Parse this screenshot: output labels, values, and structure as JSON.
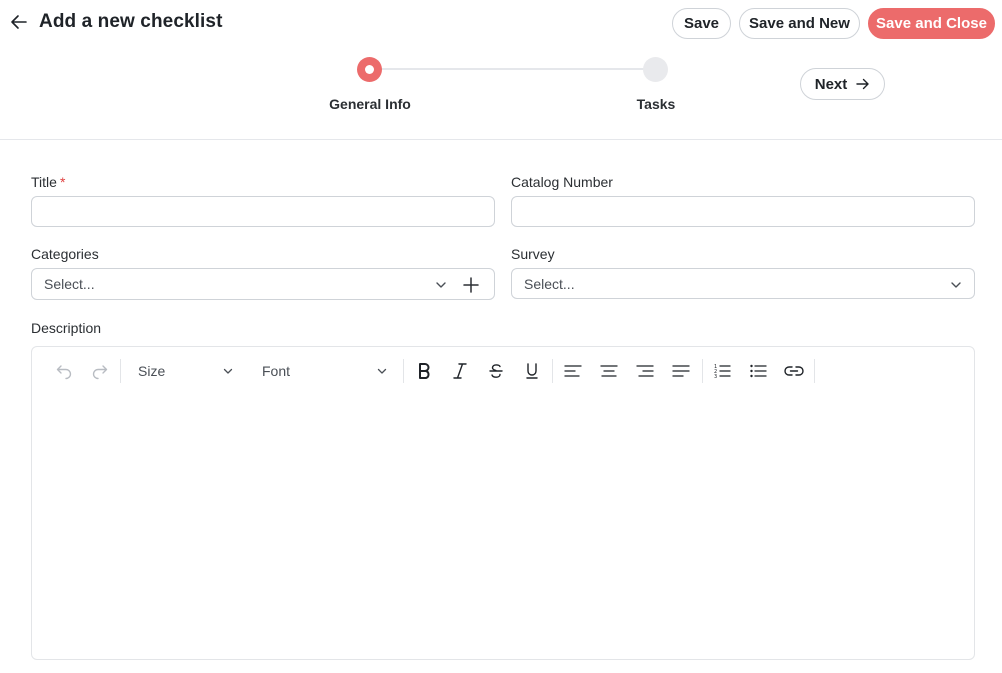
{
  "header": {
    "title": "Add a new checklist",
    "buttons": {
      "save": "Save",
      "save_and_new": "Save and New",
      "save_and_close": "Save and Close"
    }
  },
  "stepper": {
    "steps": [
      {
        "label": "General Info",
        "state": "active"
      },
      {
        "label": "Tasks",
        "state": "inactive"
      }
    ],
    "next_label": "Next"
  },
  "form": {
    "title": {
      "label": "Title",
      "required_mark": "*",
      "value": ""
    },
    "catalog_number": {
      "label": "Catalog Number",
      "value": ""
    },
    "categories": {
      "label": "Categories",
      "placeholder": "Select..."
    },
    "survey": {
      "label": "Survey",
      "placeholder": "Select..."
    },
    "description": {
      "label": "Description"
    }
  },
  "editor": {
    "size_label": "Size",
    "font_label": "Font",
    "tools": [
      "undo-icon",
      "redo-icon",
      "bold-icon",
      "italic-icon",
      "strikethrough-icon",
      "underline-icon",
      "align-left-icon",
      "align-center-icon",
      "align-right-icon",
      "align-justify-icon",
      "ordered-list-icon",
      "bullet-list-icon",
      "link-icon"
    ]
  },
  "colors": {
    "accent": "#ec6b6b",
    "border": "#cfd3d8",
    "required": "#e0403f"
  }
}
